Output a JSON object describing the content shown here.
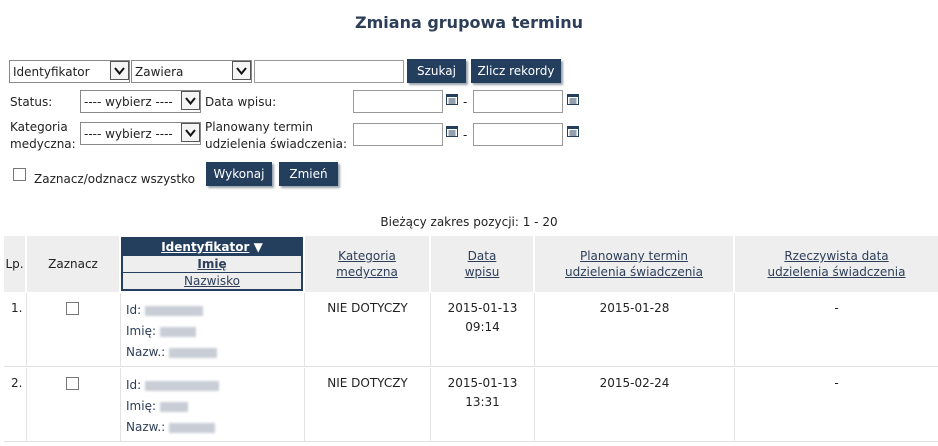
{
  "page": {
    "title": "Zmiana grupowa terminu"
  },
  "search": {
    "field_select": "Identyfikator",
    "operator_select": "Zawiera",
    "query_value": "",
    "search_button": "Szukaj",
    "count_button": "Zlicz rekordy"
  },
  "filters": {
    "status_label": "Status:",
    "status_value": "---- wybierz ----",
    "category_label_line1": "Kategoria",
    "category_label_line2": "medyczna:",
    "category_value": "---- wybierz ----",
    "entry_date_label": "Data wpisu:",
    "planned_label_line1": "Planowany termin",
    "planned_label_line2": "udzielenia świadczenia:",
    "range_dash": "-"
  },
  "actions": {
    "toggle_all_label": "Zaznacz/odznacz wszystko",
    "execute_button": "Wykonaj",
    "change_button": "Zmień"
  },
  "range_text": "Bieżący zakres pozycji: 1 - 20",
  "table": {
    "headers": {
      "lp": "Lp.",
      "select": "Zaznacz",
      "id_sort": "Identyfikator",
      "id_name": "Imię",
      "id_surname": "Nazwisko",
      "category_line1": "Kategoria",
      "category_line2": "medyczna",
      "date_line1": "Data",
      "date_line2": "wpisu",
      "planned_line1": "Planowany termin",
      "planned_line2": "udzielenia świadczenia",
      "actual_line1": "Rzeczywista data",
      "actual_line2": "udzielenia świadczenia"
    },
    "id_prefix": "Id:",
    "name_prefix": "Imię:",
    "surname_prefix": "Nazw.:",
    "rows": [
      {
        "lp": "1.",
        "category": "NIE DOTYCZY",
        "date": "2015-01-13",
        "time": "09:14",
        "planned": "2015-01-28",
        "actual": "-"
      },
      {
        "lp": "2.",
        "category": "NIE DOTYCZY",
        "date": "2015-01-13",
        "time": "13:31",
        "planned": "2015-02-24",
        "actual": "-"
      }
    ]
  },
  "icons": {
    "dropdown": "chevron-down-icon",
    "calendar": "calendar-icon",
    "sort": "sort-down-icon"
  },
  "colors": {
    "accent": "#243f5e",
    "title": "#2d3e58",
    "header_bg": "#eeeeee"
  }
}
